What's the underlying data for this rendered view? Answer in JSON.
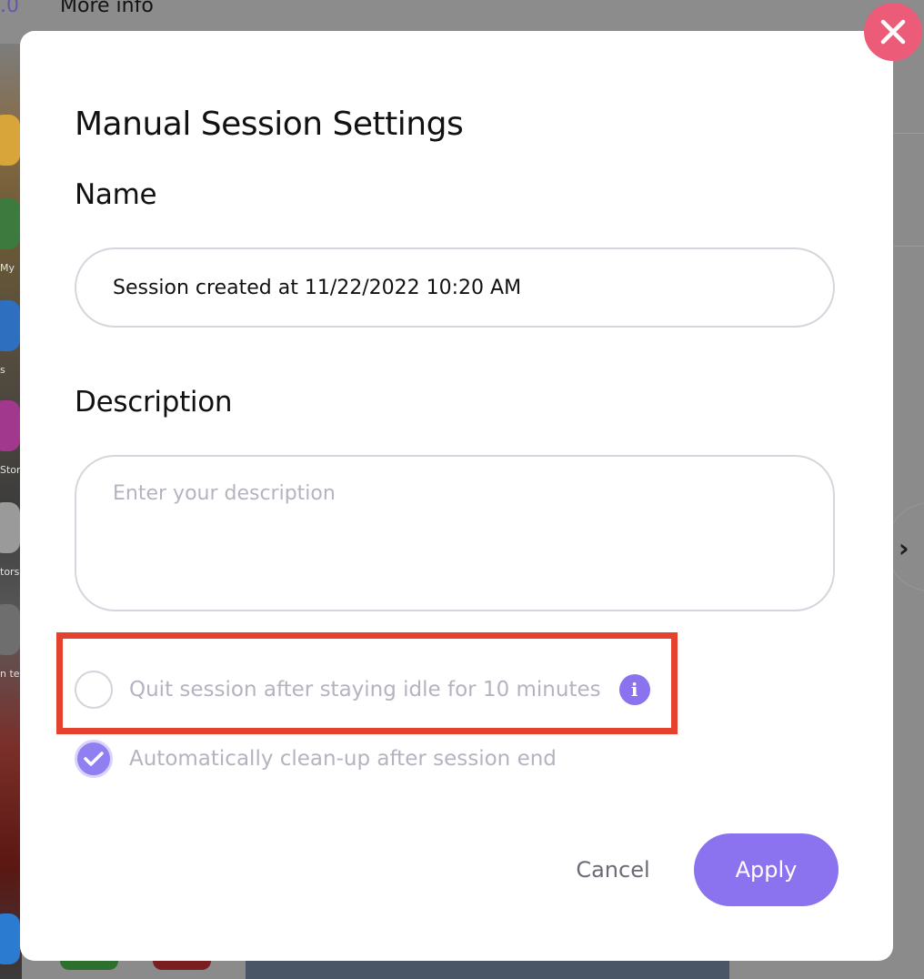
{
  "background": {
    "version_fragment": ".0",
    "more_info_label": "More info",
    "icon_labels": [
      "My",
      "s",
      "Stor",
      "tors",
      "n te"
    ]
  },
  "modal": {
    "title": "Manual Session Settings",
    "name_section": {
      "label": "Name",
      "value": "Session created at 11/22/2022 10:20 AM"
    },
    "description_section": {
      "label": "Description",
      "placeholder": "Enter your description",
      "value": ""
    },
    "options": [
      {
        "label": "Quit session after staying idle for 10 minutes",
        "checked": false,
        "has_info": true,
        "highlighted": true
      },
      {
        "label": "Automatically clean-up after session end",
        "checked": true,
        "has_info": false,
        "highlighted": false
      }
    ],
    "info_icon_glyph": "i",
    "cancel_label": "Cancel",
    "apply_label": "Apply"
  },
  "colors": {
    "accent": "#8b73ef",
    "close_button": "#ec5c78",
    "highlight_border": "#e5412f",
    "muted_text": "#b4b4c0"
  },
  "icons": {
    "close": "close-icon",
    "info": "info-icon",
    "check": "check-icon",
    "next": "chevron-right-icon"
  }
}
